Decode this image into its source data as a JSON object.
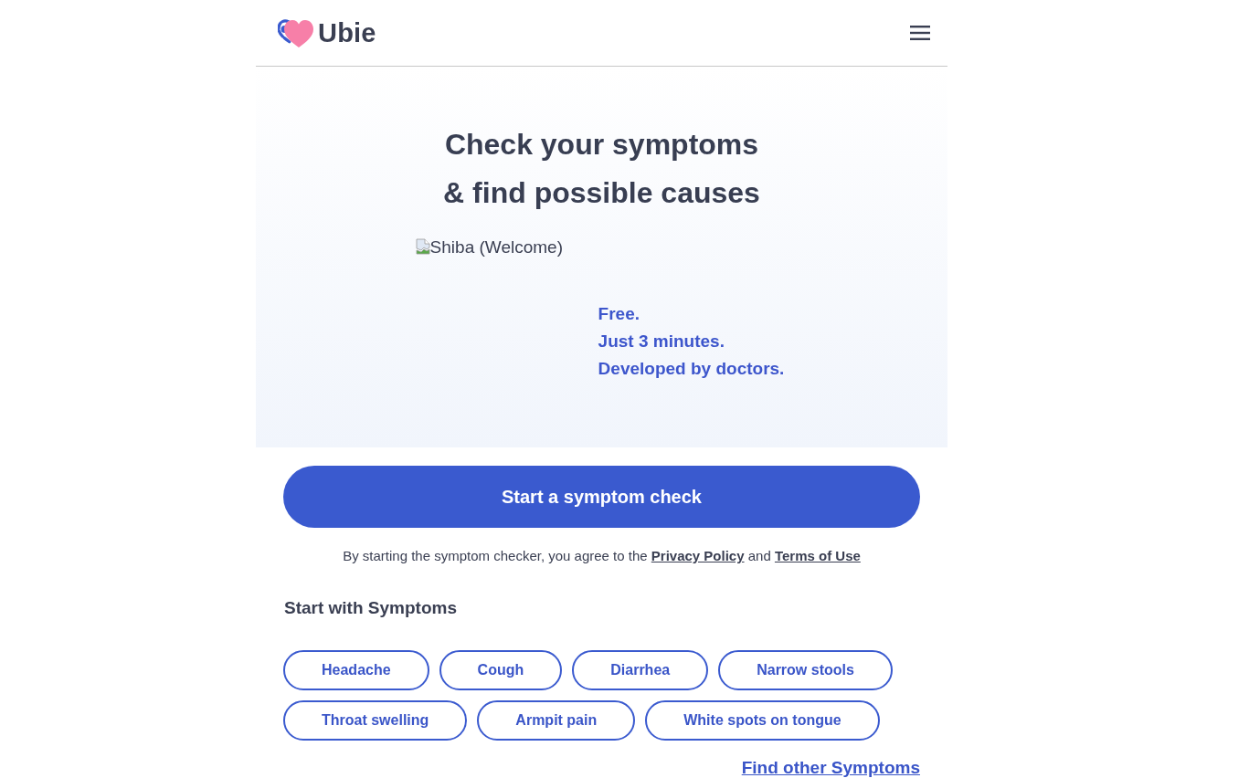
{
  "header": {
    "logo_text": "Ubie"
  },
  "hero": {
    "title_lines": [
      "Check your symptoms",
      "& find possible causes"
    ],
    "image_alt": "Shiba (Welcome)",
    "taglines": [
      "Free.",
      "Just 3 minutes.",
      "Developed by doctors."
    ]
  },
  "start_button": "Start a symptom check",
  "notice": [
    {
      "kind": "text",
      "text": "By starting the symptom checker, you agree to the "
    },
    {
      "kind": "link",
      "text": "Privacy Policy"
    },
    {
      "kind": "text",
      "text": " and "
    },
    {
      "kind": "link",
      "text": "Terms of Use"
    }
  ],
  "symptoms": {
    "heading": "Start with Symptoms",
    "chips": [
      "Headache",
      "Cough",
      "Diarrhea",
      "Narrow stools",
      "Throat swelling",
      "Armpit pain",
      "White spots on tongue"
    ],
    "more_link": "Find other Symptoms"
  }
}
